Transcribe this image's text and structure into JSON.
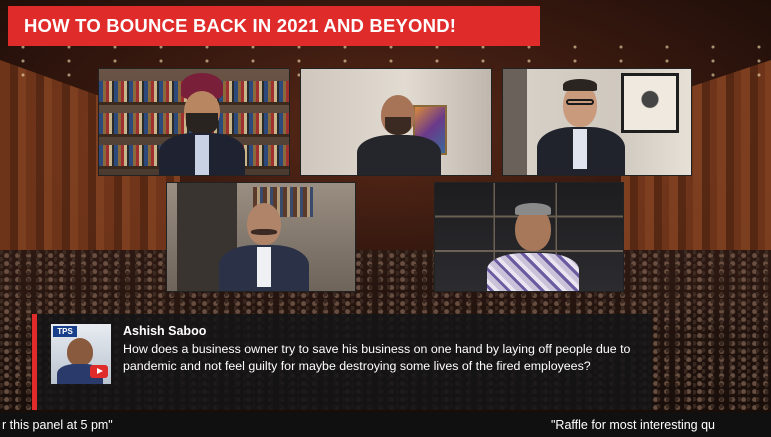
{
  "broadcast": {
    "title": "HOW TO BOUNCE BACK IN 2021 AND BEYOND!"
  },
  "panel": {
    "tiles": [
      {
        "id": "tile-1",
        "icon": "participant-turban"
      },
      {
        "id": "tile-2",
        "icon": "participant-bald-beard"
      },
      {
        "id": "tile-3",
        "icon": "participant-glasses"
      },
      {
        "id": "tile-4",
        "icon": "participant-suit"
      },
      {
        "id": "tile-5",
        "icon": "participant-checked-shirt"
      }
    ]
  },
  "comment": {
    "avatar_tag": "TPS",
    "name": "Ashish Saboo",
    "text": "How does a business owner try to save his business on one hand by laying off people due to pandemic and not feel guilty for maybe destroying some lives of the fired employees?",
    "platform_icon": "youtube-icon"
  },
  "ticker": {
    "left": "r this panel at 5 pm\"",
    "right": "\"Raffle for most interesting qu"
  },
  "colors": {
    "accent": "#e02b2b",
    "card_bg": "#141416"
  }
}
